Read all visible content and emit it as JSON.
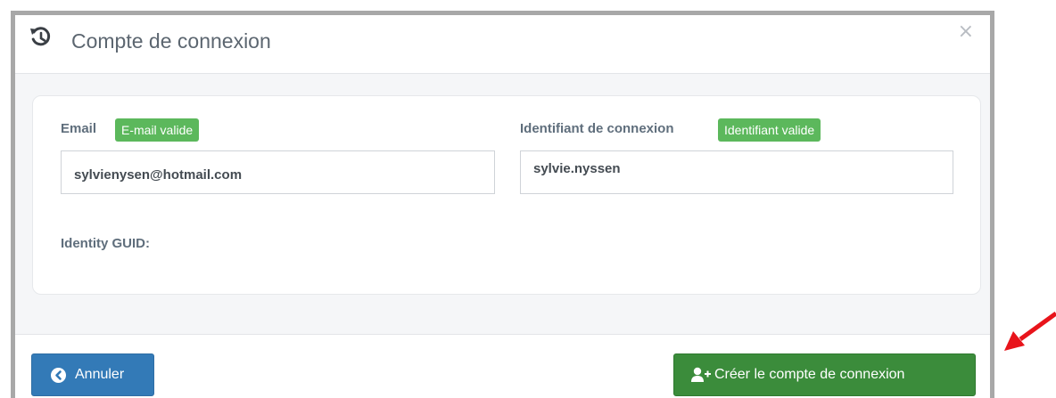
{
  "modal": {
    "title": "Compte de connexion",
    "title_icon": "history-icon",
    "close_label": "×"
  },
  "form": {
    "email_label": "Email",
    "email_badge": "E-mail valide",
    "email_value": "sylvienysen@hotmail.com",
    "login_label": "Identifiant de connexion",
    "login_badge": "Identifiant valide",
    "login_value": "sylvie.nyssen",
    "guid_label": "Identity GUID:"
  },
  "footer": {
    "cancel_label": "Annuler",
    "cancel_icon": "arrow-left-circle-icon",
    "create_label": "Créer le compte de connexion",
    "create_icon": "user-plus-icon"
  },
  "annotation": {
    "arrow_icon": "red-arrow-icon",
    "arrow_color": "#e8141b"
  },
  "colors": {
    "badge_green": "#5cb85c",
    "primary_blue": "#337ab7",
    "success_green": "#3b8c3b"
  }
}
